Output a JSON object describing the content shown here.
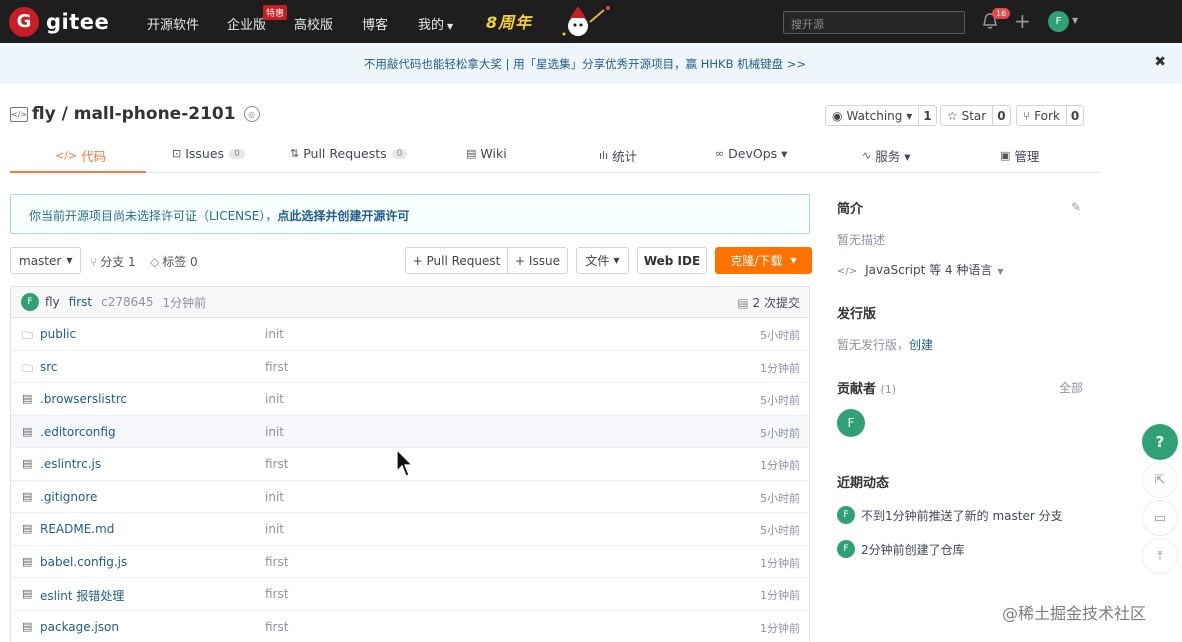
{
  "topnav": {
    "logo_letter": "G",
    "logo_text": "gitee",
    "items": [
      {
        "label": "开源软件"
      },
      {
        "label": "企业版"
      },
      {
        "label": "高校版"
      },
      {
        "label": "博客"
      },
      {
        "label": "我的"
      }
    ],
    "hot_badge": "特惠",
    "anniversary": "8周年",
    "search_placeholder": "搜开源",
    "notification_count": "16",
    "avatar_letter": "F"
  },
  "banner": {
    "text": "不用敲代码也能轻松拿大奖 | 用「星选集」分享优秀开源项目，赢 HHKB 机械键盘 >>",
    "close": "✖"
  },
  "repo": {
    "title": "fly / mall-phone-2101",
    "watch_label": "Watching ▾",
    "watch_count": "1",
    "star_label": "☆ Star",
    "star_count": "0",
    "fork_label": "Fork",
    "fork_count": "0"
  },
  "tabs": [
    {
      "icon": "</>",
      "label": "代码"
    },
    {
      "icon": "⊡",
      "label": "Issues",
      "count": "0"
    },
    {
      "icon": "⇅",
      "label": "Pull Requests",
      "count": "0"
    },
    {
      "icon": "▤",
      "label": "Wiki"
    },
    {
      "icon": "ılı",
      "label": "统计"
    },
    {
      "icon": "∞",
      "label": "DevOps ▾"
    },
    {
      "icon": "∿",
      "label": "服务 ▾"
    },
    {
      "icon": "▣",
      "label": "管理"
    }
  ],
  "notice": {
    "text": "你当前开源项目尚未选择许可证（LICENSE），",
    "link": "点此选择并创建开源许可"
  },
  "branch_bar": {
    "branch": "master",
    "branches": "分支 1",
    "tags": "标签 0",
    "pull_request": "+ Pull Request",
    "issue": "+ Issue",
    "file": "文件",
    "web_ide": "Web IDE",
    "clone": "克隆/下载"
  },
  "commit": {
    "avatar": "F",
    "author": "fly",
    "message": "first",
    "hash": "c278645",
    "time": "1分钟前",
    "count": "2 次提交"
  },
  "files": [
    {
      "type": "folder",
      "name": "public",
      "msg": "init",
      "time": "5小时前"
    },
    {
      "type": "folder",
      "name": "src",
      "msg": "first",
      "time": "1分钟前"
    },
    {
      "type": "file",
      "name": ".browserslistrc",
      "msg": "init",
      "time": "5小时前"
    },
    {
      "type": "file",
      "name": ".editorconfig",
      "msg": "init",
      "time": "5小时前"
    },
    {
      "type": "file",
      "name": ".eslintrc.js",
      "msg": "first",
      "time": "1分钟前"
    },
    {
      "type": "file",
      "name": ".gitignore",
      "msg": "init",
      "time": "5小时前"
    },
    {
      "type": "file",
      "name": "README.md",
      "msg": "init",
      "time": "5小时前"
    },
    {
      "type": "file",
      "name": "babel.config.js",
      "msg": "first",
      "time": "1分钟前"
    },
    {
      "type": "file",
      "name": "eslint 报错处理",
      "msg": "first",
      "time": "1分钟前"
    },
    {
      "type": "file",
      "name": "package.json",
      "msg": "first",
      "time": "1分钟前"
    }
  ],
  "sidebar": {
    "intro_title": "简介",
    "intro_text": "暂无描述",
    "lang_text": "JavaScript 等 4 种语言",
    "release_title": "发行版",
    "release_text": "暂无发行版，",
    "release_link": "创建",
    "contrib_title": "贡献者",
    "contrib_count": "(1)",
    "contrib_all": "全部",
    "contrib_avatar": "F",
    "activity_title": "近期动态",
    "activity_1": "不到1分钟前推送了新的 master 分支",
    "activity_2": "2分钟前创建了仓库"
  },
  "watermark": "@稀土掘金技术社区"
}
